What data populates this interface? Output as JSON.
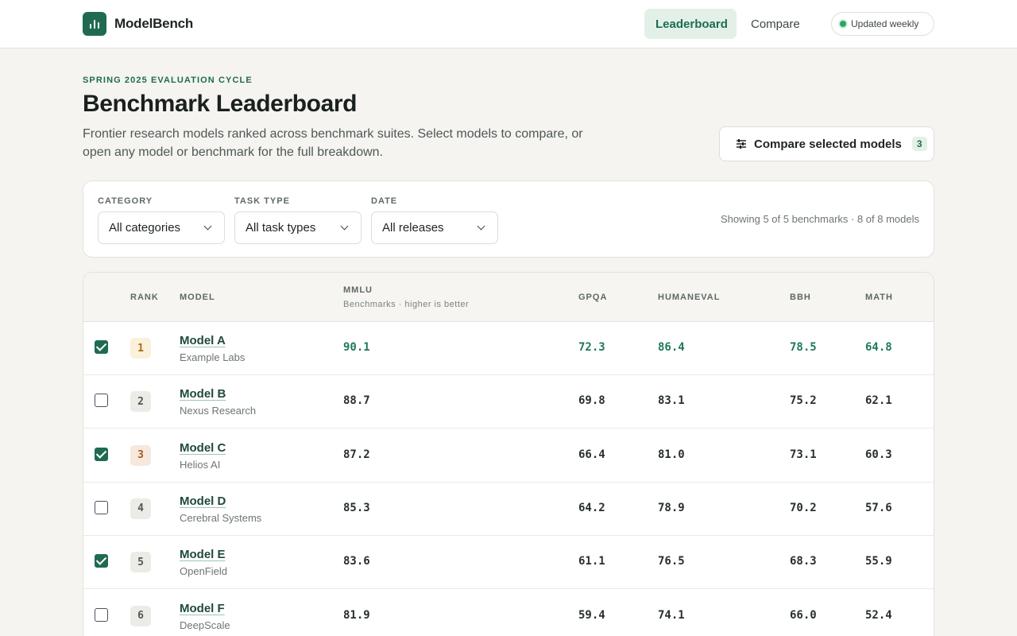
{
  "header": {
    "brand": "ModelBench",
    "nav": [
      {
        "label": "Leaderboard",
        "active": true
      },
      {
        "label": "Compare",
        "active": false
      }
    ],
    "status_badge": "Updated weekly"
  },
  "hero": {
    "eyebrow": "SPRING 2025 EVALUATION CYCLE",
    "title": "Benchmark Leaderboard",
    "description": "Frontier research models ranked across benchmark suites. Select models to compare, or open any model or benchmark for the full breakdown.",
    "compare_label": "Compare selected models",
    "compare_count": "3"
  },
  "filters": {
    "category": {
      "label": "CATEGORY",
      "value": "All categories"
    },
    "task_type": {
      "label": "TASK TYPE",
      "value": "All task types"
    },
    "date": {
      "label": "DATE",
      "value": "All releases"
    },
    "summary": "Showing 5 of 5 benchmarks · 8 of 8 models"
  },
  "table": {
    "headers": {
      "rank": "RANK",
      "model": "MODEL",
      "mmlu": "MMLU",
      "mmlu_sub": "Benchmarks · higher is better",
      "gpqa": "GPQA",
      "humaneval": "HUMANEVAL",
      "bbh": "BBH",
      "math": "MATH"
    },
    "rows": [
      {
        "checked": true,
        "rank": "1",
        "name": "Model A",
        "org": "Example Labs",
        "scores": [
          "90.1",
          "72.3",
          "86.4",
          "78.5",
          "64.8"
        ]
      },
      {
        "checked": false,
        "rank": "2",
        "name": "Model B",
        "org": "Nexus Research",
        "scores": [
          "88.7",
          "69.8",
          "83.1",
          "75.2",
          "62.1"
        ]
      },
      {
        "checked": true,
        "rank": "3",
        "name": "Model C",
        "org": "Helios AI",
        "scores": [
          "87.2",
          "66.4",
          "81.0",
          "73.1",
          "60.3"
        ]
      },
      {
        "checked": false,
        "rank": "4",
        "name": "Model D",
        "org": "Cerebral Systems",
        "scores": [
          "85.3",
          "64.2",
          "78.9",
          "70.2",
          "57.6"
        ]
      },
      {
        "checked": true,
        "rank": "5",
        "name": "Model E",
        "org": "OpenField",
        "scores": [
          "83.6",
          "61.1",
          "76.5",
          "68.3",
          "55.9"
        ]
      },
      {
        "checked": false,
        "rank": "6",
        "name": "Model F",
        "org": "DeepScale",
        "scores": [
          "81.9",
          "59.4",
          "74.1",
          "66.0",
          "52.4"
        ]
      }
    ]
  },
  "colors": {
    "accent": "#1f6b52",
    "background": "#f5f4f0"
  }
}
